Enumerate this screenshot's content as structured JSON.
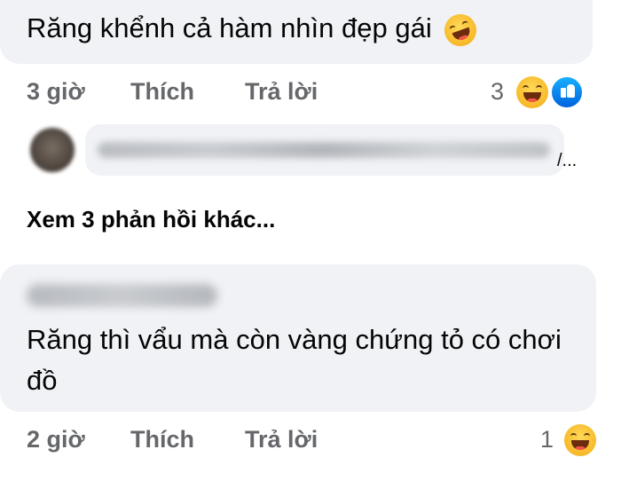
{
  "comment1": {
    "text": "Răng khểnh cả hàm nhìn đẹp gái",
    "emoji_icon": "rolling-laughing-emoji",
    "time": "3 giờ",
    "like_label": "Thích",
    "reply_label": "Trả lời",
    "reaction_count": "3",
    "reactions": [
      "haha-icon",
      "like-icon"
    ]
  },
  "reply_preview": {
    "ellipsis": "/..."
  },
  "view_more": "Xem 3 phản hồi khác...",
  "comment2": {
    "text": "Răng thì vẩu mà còn vàng chứng tỏ có chơi đồ",
    "time": "2 giờ",
    "like_label": "Thích",
    "reply_label": "Trả lời",
    "reaction_count": "1",
    "reactions": [
      "haha-icon"
    ]
  },
  "colors": {
    "bubble_bg": "#f0f2f5",
    "meta_text": "#65676b",
    "like_blue": "#1877f2"
  }
}
